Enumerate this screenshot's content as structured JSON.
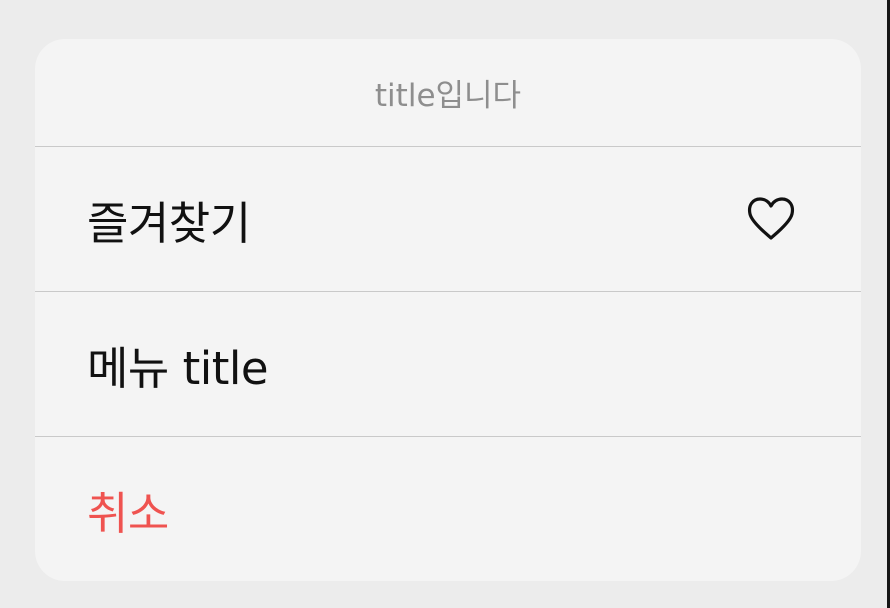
{
  "sheet": {
    "title": "title입니다",
    "items": [
      {
        "label": "즐겨찾기",
        "icon": "heart-icon"
      },
      {
        "label": "메뉴 title"
      },
      {
        "label": "취소",
        "color": "#ef5350"
      }
    ]
  },
  "colors": {
    "background": "#ececec",
    "sheet": "#f4f4f4",
    "divider": "#c9c9c9",
    "title_text": "#8e8e8e",
    "destructive": "#ef5350"
  }
}
